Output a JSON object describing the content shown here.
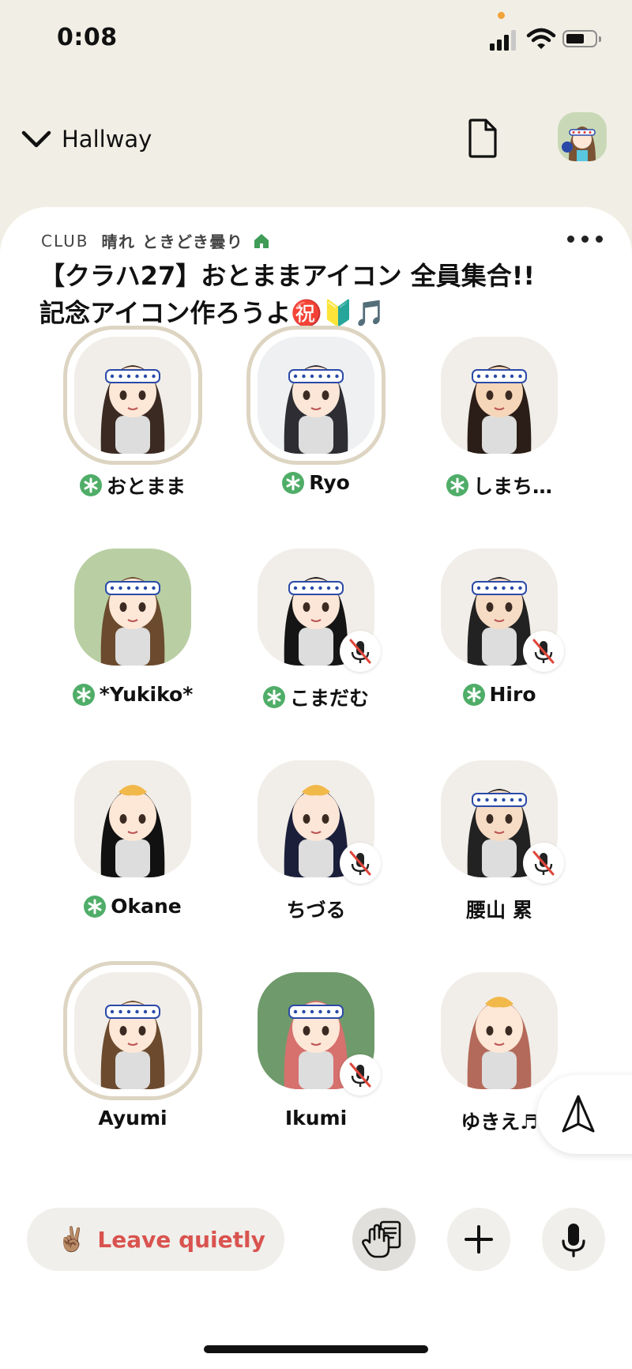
{
  "status_bar": {
    "time": "0:08"
  },
  "header": {
    "back_label": "Hallway"
  },
  "room": {
    "club_prefix": "CLUB",
    "club_name": "晴れ ときどき曇り",
    "title": "【クラハ27】おとままアイコン 全員集合!!記念アイコン作ろうよ㊗️🔰🎵"
  },
  "speakers": [
    {
      "name": "おとまま",
      "moderator": true,
      "muted": false,
      "ring": true
    },
    {
      "name": "Ryo",
      "moderator": true,
      "muted": false,
      "ring": true
    },
    {
      "name": "しまち…",
      "moderator": true,
      "muted": false,
      "ring": false
    },
    {
      "name": "*Yukiko*",
      "moderator": true,
      "muted": false,
      "ring": false
    },
    {
      "name": "こまだむ",
      "moderator": true,
      "muted": true,
      "ring": false
    },
    {
      "name": "Hiro",
      "moderator": true,
      "muted": true,
      "ring": false
    },
    {
      "name": "Okane",
      "moderator": true,
      "muted": false,
      "ring": false
    },
    {
      "name": "ちづる",
      "moderator": false,
      "muted": true,
      "ring": false
    },
    {
      "name": "腰山 累",
      "moderator": false,
      "muted": true,
      "ring": false
    },
    {
      "name": "Ayumi",
      "moderator": false,
      "muted": false,
      "ring": true
    },
    {
      "name": "Ikumi",
      "moderator": false,
      "muted": true,
      "ring": false
    },
    {
      "name": "ゆきえ♬",
      "moderator": false,
      "muted": false,
      "ring": false
    }
  ],
  "bottom_bar": {
    "leave_emoji": "✌🏽",
    "leave_label": "Leave quietly"
  },
  "colors": {
    "background": "#f1efe5",
    "moderator_badge": "#4fad68",
    "leave_text": "#d9534f",
    "club_home": "#3f9c57"
  }
}
